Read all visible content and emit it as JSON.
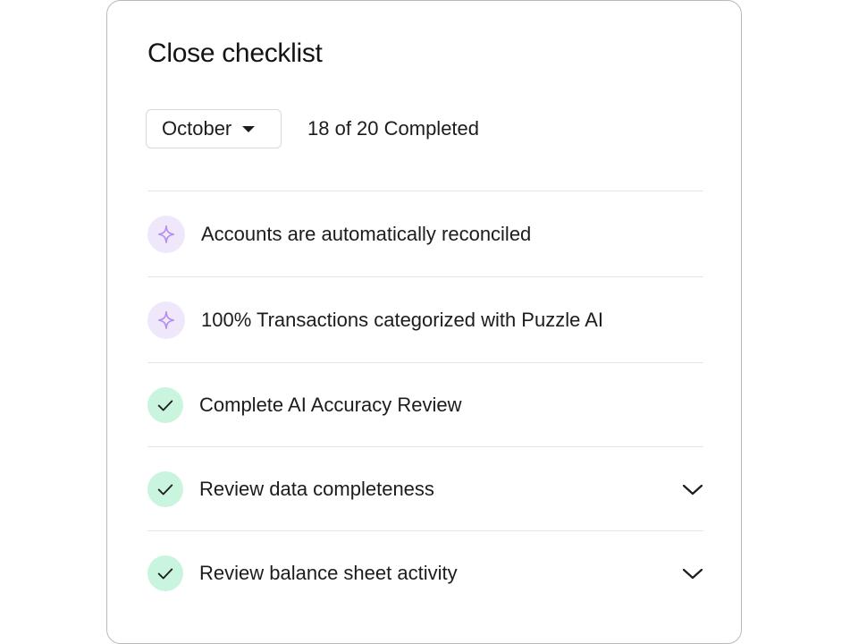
{
  "checklist": {
    "title": "Close checklist",
    "month_selected": "October",
    "progress_text": "18 of 20 Completed",
    "colors": {
      "ai_badge_bg": "#efe8fb",
      "ai_icon": "#b48cf2",
      "done_badge_bg": "#c9f5df",
      "check_icon": "#1c1c1c"
    },
    "items": [
      {
        "label": "Accounts are automatically reconciled",
        "icon": "sparkle-icon",
        "status": "ai"
      },
      {
        "label": "100% Transactions categorized with Puzzle AI",
        "icon": "sparkle-icon",
        "status": "ai"
      },
      {
        "label": "Complete AI Accuracy Review",
        "icon": "check-icon",
        "status": "done"
      },
      {
        "label": "Review data completeness",
        "icon": "check-icon",
        "status": "done",
        "expandable": true
      },
      {
        "label": "Review balance sheet activity",
        "icon": "check-icon",
        "status": "done",
        "expandable": true
      }
    ]
  }
}
